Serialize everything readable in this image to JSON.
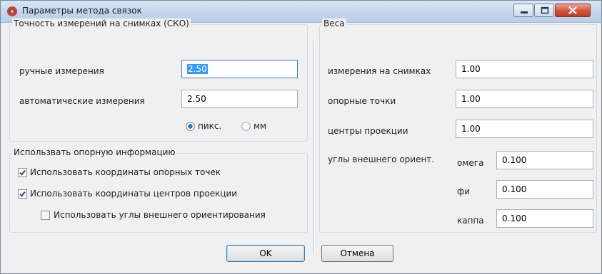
{
  "window": {
    "title": "Параметры метода связок",
    "icon": "app-icon",
    "controls": [
      "minimize-icon",
      "maximize-icon",
      "close-icon"
    ]
  },
  "accuracy": {
    "legend": "Точность измерений на снимках (СКО)",
    "manual_label": "ручные измерения",
    "manual_value": "2.50",
    "auto_label": "автоматические измерения",
    "auto_value": "2.50",
    "unit_pix": "пикс.",
    "unit_mm": "мм",
    "selected_unit": "пикс."
  },
  "control_info": {
    "legend": "Использвать опорную информацию",
    "use_control_points": "Использовать координаты опорных точек",
    "use_control_points_checked": true,
    "use_projection_centers": "Использовать координаты центров проекции",
    "use_projection_centers_checked": true,
    "use_exterior_angles": "Использовать углы внешнего ориентирования",
    "use_exterior_angles_checked": false
  },
  "weights": {
    "legend": "Веса",
    "image_measurements_label": "измерения на снимках",
    "image_measurements_value": "1.00",
    "control_points_label": "опорные точки",
    "control_points_value": "1.00",
    "projection_centers_label": "центры проекции",
    "projection_centers_value": "1.00",
    "exterior_angles_label": "углы внешнего ориент.",
    "omega_label": "омега",
    "omega_value": "0.100",
    "phi_label": "фи",
    "phi_value": "0.100",
    "kappa_label": "каппа",
    "kappa_value": "0.100"
  },
  "buttons": {
    "ok": "OK",
    "cancel": "Отмена"
  },
  "colors": {
    "selection": "#3399ff",
    "focus_border": "#3d7bd1",
    "close_button": "#c13a24"
  }
}
